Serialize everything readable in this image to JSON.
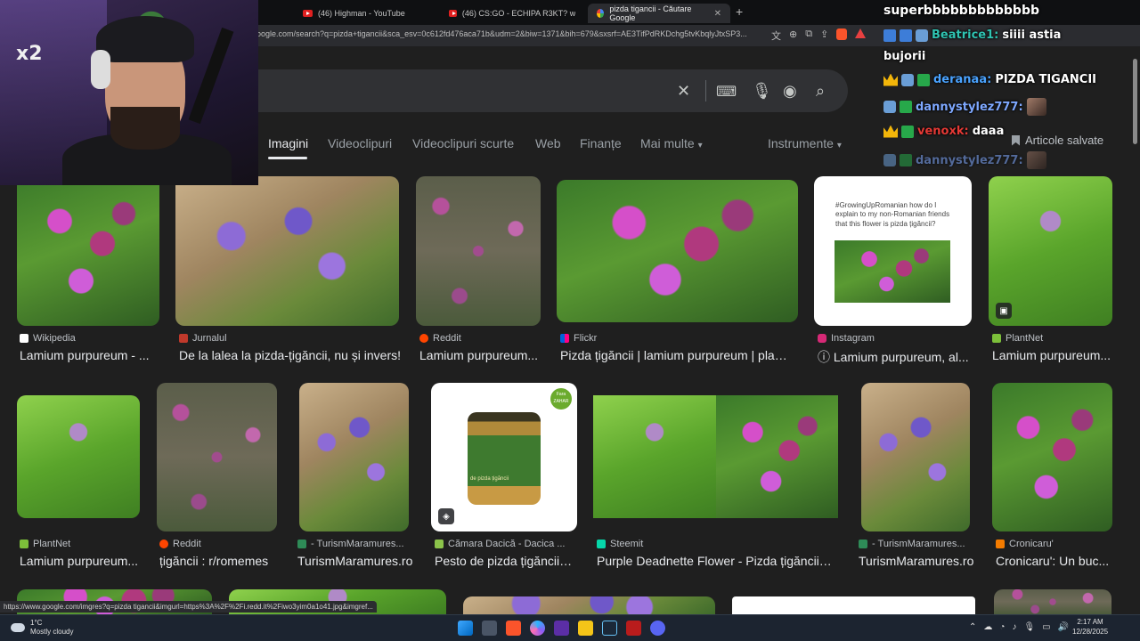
{
  "browser": {
    "tabs": [
      {
        "title": "(46) Highman - YouTube",
        "icon": "youtube-icon",
        "active": false
      },
      {
        "title": "(46) CS:GO - ECHIPA R3KT? w/ Maxsk",
        "icon": "youtube-icon",
        "active": false
      },
      {
        "title": "pizda tigancii - Căutare Google",
        "icon": "google-icon",
        "active": true
      }
    ],
    "new_tab": "+",
    "url": "oogle.com/search?q=pizda+tigancii&sca_esv=0c612fd476aca71b&udm=2&biw=1371&bih=679&sxsrf=AE3TifPdRKDchg5tvKbqlyJtxSP3..."
  },
  "search": {
    "query": "",
    "clear_icon": "close-icon",
    "keyboard_icon": "keyboard-icon",
    "mic_icon": "microphone-icon",
    "lens_icon": "camera-icon",
    "search_icon": "search-icon"
  },
  "nav": {
    "tabs": [
      "Imagini",
      "Videoclipuri",
      "Videoclipuri scurte",
      "Web",
      "Finanțe",
      "Mai multe"
    ],
    "more_arrow": "▾",
    "tools": "Instrumente",
    "saved": "Articole salvate"
  },
  "results": [
    {
      "source": "Wikipedia",
      "caption": "Lamium purpureum - ...",
      "favicon_color": "#ffffff"
    },
    {
      "source": "Jurnalul",
      "caption": "De la lalea la pizda-țigăncii, nu și invers!",
      "favicon_color": "#c0392b"
    },
    {
      "source": "Reddit",
      "caption": "Lamium purpureum...",
      "favicon_color": "#ff4500"
    },
    {
      "source": "Flickr",
      "caption": "Pizda țigăncii | lamium purpureum | plant...",
      "favicon_color": "#0063dc"
    },
    {
      "source": "Instagram",
      "caption": "ⓘ Lamium purpureum, al...",
      "favicon_color": "#d62976"
    },
    {
      "source": "PlantNet",
      "caption": "Lamium purpureum...",
      "favicon_color": "#7cbf3a"
    },
    {
      "source": "PlantNet",
      "caption": "Lamium purpureum...",
      "favicon_color": "#7cbf3a"
    },
    {
      "source": "Reddit",
      "caption": "țigăncii : r/romemes",
      "favicon_color": "#ff4500"
    },
    {
      "source": "- TurismMaramures...",
      "caption": "TurismMaramures.ro",
      "favicon_color": "#2e8b57"
    },
    {
      "source": "Cămara Dacică - Dacica ...",
      "caption": "Pesto de pizda țigăncii ...",
      "favicon_color": "#8bc34a"
    },
    {
      "source": "Steemit",
      "caption": "Purple Deadnette Flower - Pizda țigăncii ...",
      "favicon_color": "#06d6a9"
    },
    {
      "source": "- TurismMaramures...",
      "caption": "TurismMaramures.ro",
      "favicon_color": "#2e8b57"
    },
    {
      "source": "Cronicaru'",
      "caption": "Cronicaru': Un buc...",
      "favicon_color": "#f57c00"
    }
  ],
  "instagram_card_text": "#GrowingUpRomanian how do I explain to my non-Romanian friends that this flower is pizda țigăncii?",
  "jar_label": "de pizda țigăncii",
  "jar_badge": "Fara ZAHAR",
  "overlay": {
    "cam_logo": "x2",
    "chat": [
      {
        "user": "superbbbbbbbbbbbbb",
        "message": "",
        "color": "#ffffff"
      },
      {
        "user": "Beatrice1:",
        "message": "siiii astia",
        "color": "#2fc4b2"
      },
      {
        "user": "",
        "message": "bujorii",
        "color": "#ffffff"
      },
      {
        "user": "deranaa:",
        "message": "PIZDA TIGANCII",
        "color": "#4aa3ff"
      },
      {
        "user": "dannystylez777:",
        "message": "",
        "color": "#7ea8ff"
      },
      {
        "user": "venoxk:",
        "message": "daaa",
        "color": "#e53935"
      },
      {
        "user": "dannystylez777:",
        "message": "",
        "color": "#7ea8ff"
      }
    ]
  },
  "status_url": "https://www.google.com/imgres?q=pizda tigancii&imgurl=https%3A%2F%2Fi.redd.it%2Fiwo3yim0a1o41.jpg&imgref...",
  "taskbar": {
    "weather_temp": "1°C",
    "weather_desc": "Mostly cloudy",
    "time": "2:17 AM",
    "date": "12/28/2025"
  }
}
